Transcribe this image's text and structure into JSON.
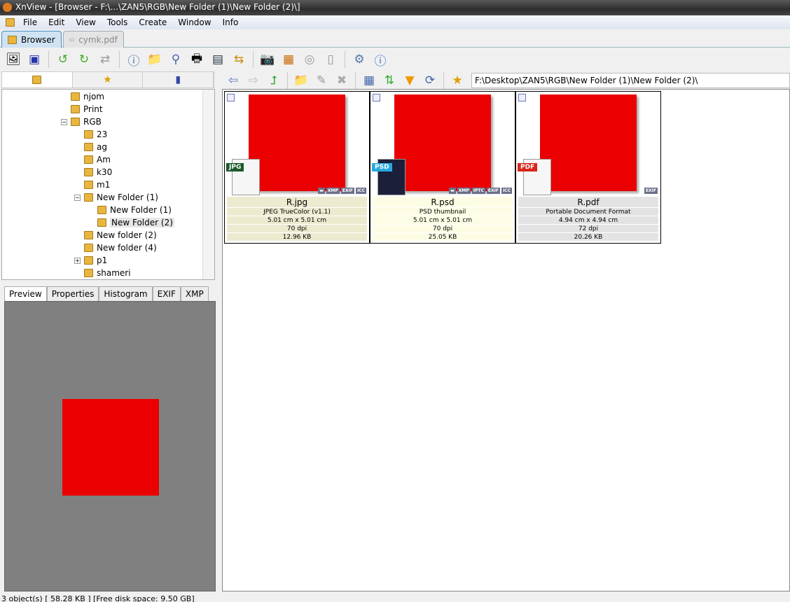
{
  "title": "XnView - [Browser - F:\\...\\ZAN5\\RGB\\New Folder (1)\\New Folder (2)\\]",
  "menu": [
    "File",
    "Edit",
    "View",
    "Tools",
    "Create",
    "Window",
    "Info"
  ],
  "tabs": [
    {
      "label": "Browser",
      "active": true
    },
    {
      "label": "cymk.pdf",
      "active": false
    }
  ],
  "tree": [
    {
      "label": "njom",
      "level": 0
    },
    {
      "label": "Print",
      "level": 0
    },
    {
      "label": "RGB",
      "level": 0,
      "expanded": true
    },
    {
      "label": "23",
      "level": 1
    },
    {
      "label": "ag",
      "level": 1
    },
    {
      "label": "Am",
      "level": 1
    },
    {
      "label": "k30",
      "level": 1
    },
    {
      "label": "m1",
      "level": 1
    },
    {
      "label": "New Folder (1)",
      "level": 1,
      "expanded": true
    },
    {
      "label": "New Folder (1)",
      "level": 2
    },
    {
      "label": "New Folder (2)",
      "level": 2,
      "selected": true
    },
    {
      "label": "New folder (2)",
      "level": 1
    },
    {
      "label": "New folder (4)",
      "level": 1
    },
    {
      "label": "p1",
      "level": 1,
      "collapsed": true
    },
    {
      "label": "shameri",
      "level": 1
    }
  ],
  "preview_tabs": [
    "Preview",
    "Properties",
    "Histogram",
    "EXIF",
    "XMP"
  ],
  "path": "F:\\Desktop\\ZAN5\\RGB\\New Folder (1)\\New Folder (2)\\",
  "files": [
    {
      "name": "R.jpg",
      "type_label": "JPG",
      "type_color": "#1d5a2c",
      "bg": "#ecebd0",
      "lines": [
        "JPEG TrueColor (v1.1)",
        "5.01 cm x 5.01 cm",
        "70 dpi",
        "12.96 KB"
      ],
      "badges": [
        "▬",
        "XMP",
        "EXIF",
        "ICC"
      ]
    },
    {
      "name": "R.psd",
      "type_label": "PSD",
      "type_color": "#29a8e0",
      "bg": "#fdfde5",
      "lines": [
        "PSD thumbnail",
        "5.01 cm x 5.01 cm",
        "70 dpi",
        "25.05 KB"
      ],
      "badges": [
        "▬",
        "XMP",
        "IPTC",
        "EXIF",
        "ICC"
      ]
    },
    {
      "name": "R.pdf",
      "type_label": "PDF",
      "type_color": "#d8261c",
      "bg": "#e3e3e3",
      "lines": [
        "Portable Document Format",
        "4.94 cm x 4.94 cm",
        "72 dpi",
        "20.26 KB"
      ],
      "badges": [
        "EXIF"
      ]
    }
  ],
  "status": "3 object(s) [ 58.28 KB ] [Free disk space: 9.50 GB]",
  "colors": {
    "image_red": "#ea0000",
    "preview_bg": "#808080"
  }
}
